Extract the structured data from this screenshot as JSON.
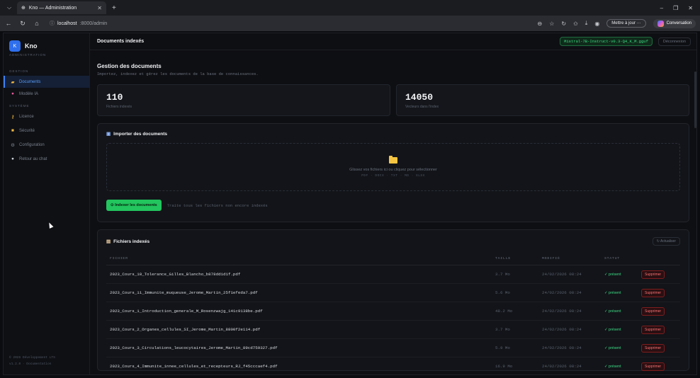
{
  "browser": {
    "tab_title": "Kno — Administration",
    "url_host": "localhost",
    "url_path": ":8000/admin",
    "update_label": "Mettre à jour ···",
    "conversation_label": "Conversation"
  },
  "sidebar": {
    "logo_letter": "K",
    "brand": "Kno",
    "brand_sub": "ADMINISTRATION",
    "section_gestion": "GESTION",
    "section_systeme": "SYSTÈME",
    "items": [
      {
        "label": "Documents",
        "icon": "folder-icon"
      },
      {
        "label": "Modèle IA",
        "icon": "brain-icon"
      },
      {
        "label": "Licence",
        "icon": "key-icon"
      },
      {
        "label": "Sécurité",
        "icon": "lock-icon"
      },
      {
        "label": "Configuration",
        "icon": "gear-icon"
      },
      {
        "label": "Retour au chat",
        "icon": "chat-bubble-icon"
      }
    ],
    "footer_line1": "© 2026 Développement LTS",
    "footer_line2": "v1.2.0  ·  Documentation"
  },
  "topbar": {
    "title": "Documents indexés",
    "model": "Mistral-7B-Instruct-v0.3-Q4_K_M.gguf",
    "logout": "Déconnexion"
  },
  "page": {
    "title": "Gestion des documents",
    "subtitle": "Importez, indexez et gérez les documents de la base de connaissances."
  },
  "stats": [
    {
      "value": "110",
      "label": "Fichiers indexés"
    },
    {
      "value": "14050",
      "label": "Vecteurs dans l'index"
    }
  ],
  "import": {
    "title": "Importer des documents",
    "drop_text": "Glissez vos fichiers ici ou cliquez pour sélectionner",
    "formats": "PDF · DOCX · TXT · MD · XLSX",
    "index_button": "⊙ Indexer les documents",
    "index_hint": "Traite tous les fichiers non encore indexés"
  },
  "files": {
    "title": "Fichiers indexés",
    "refresh": "↻ Actualiser",
    "columns": [
      "FICHIER",
      "TAILLE",
      "MODIFIÉ",
      "STATUT"
    ],
    "delete_label": "Supprimer",
    "rows": [
      {
        "name": "2023_Cours_10_Tolerance_Gilles_Blancho_b878dd1d1f.pdf",
        "size": "3.7 Mo",
        "date": "24/02/2026 08:24",
        "status": "✓ présent"
      },
      {
        "name": "2023_Cours_11_Immunite_muqueuse_Jerome_Martin_25f1efeda7.pdf",
        "size": "5.6 Mo",
        "date": "24/02/2026 08:24",
        "status": "✓ présent"
      },
      {
        "name": "2023_Cours_1_Introduction_generale_M_Rosenzwajg_141c9138be.pdf",
        "size": "48.2 Mo",
        "date": "24/02/2026 08:24",
        "status": "✓ présent"
      },
      {
        "name": "2023_Cours_2_Organes_cellules_SI_Jerome_Martin_8800f2e114.pdf",
        "size": "3.7 Mo",
        "date": "24/02/2026 08:24",
        "status": "✓ présent"
      },
      {
        "name": "2023_Cours_3_Circulations_leucocytaires_Jerome_Martin_89cd759327.pdf",
        "size": "5.9 Mo",
        "date": "24/02/2026 08:24",
        "status": "✓ présent"
      },
      {
        "name": "2023_Cours_4_Immunite_innee_cellules_et_recepteurs_RJ_f45cccaef4.pdf",
        "size": "16.9 Mo",
        "date": "24/02/2026 08:24",
        "status": "✓ présent"
      }
    ]
  }
}
